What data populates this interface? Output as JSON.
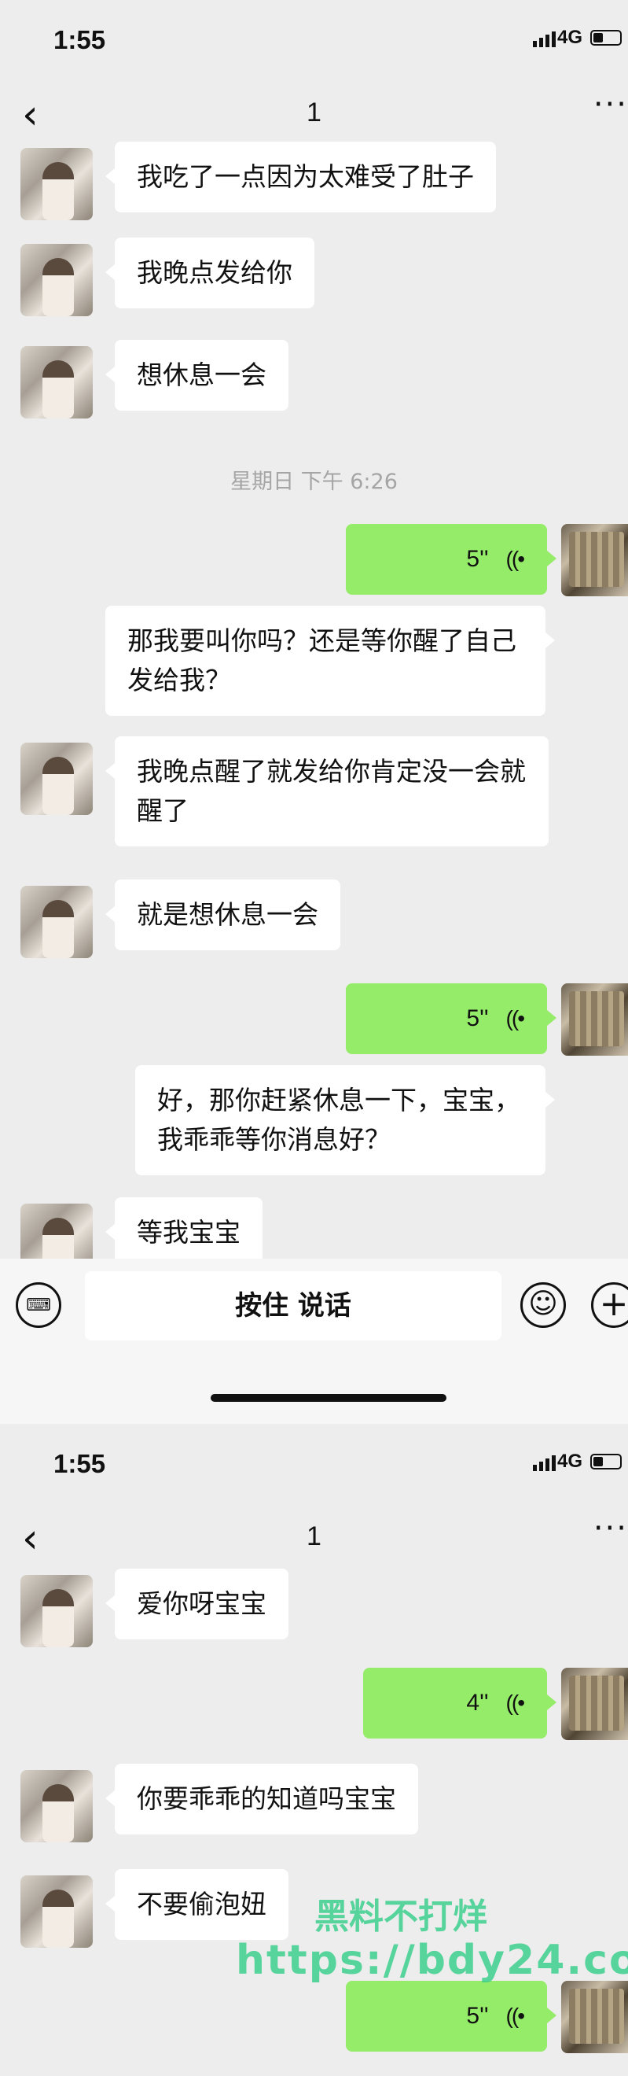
{
  "screens": [
    {
      "status": {
        "time": "1:55",
        "network": "4G"
      },
      "nav": {
        "back_icon": "‹",
        "title": "1",
        "more_icon": "···"
      },
      "messages": [
        {
          "side": "in",
          "text": "我吃了一点因为太难受了肚子"
        },
        {
          "side": "in",
          "text": "我晚点发给你"
        },
        {
          "side": "in",
          "text": "想休息一会"
        },
        {
          "type": "time",
          "text": "星期日 下午 6:26"
        },
        {
          "side": "out",
          "type": "voice",
          "duration": "5''"
        },
        {
          "side": "out",
          "text": "那我要叫你吗？还是等你醒了自己发给我？"
        },
        {
          "side": "in",
          "text": "我晚点醒了就发给你肯定没一会就醒了"
        },
        {
          "side": "in",
          "text": "就是想休息一会"
        },
        {
          "side": "out",
          "type": "voice",
          "duration": "5''"
        },
        {
          "side": "out",
          "text": "好，那你赶紧休息一下，宝宝，我乖乖等你消息好？"
        },
        {
          "side": "in",
          "text": "等我宝宝"
        }
      ],
      "input": {
        "hold_to_talk": "按住 说话"
      }
    },
    {
      "status": {
        "time": "1:55",
        "network": "4G"
      },
      "nav": {
        "back_icon": "‹",
        "title": "1",
        "more_icon": "···"
      },
      "messages": [
        {
          "side": "in",
          "text": "爱你呀宝宝"
        },
        {
          "side": "out",
          "type": "voice",
          "duration": "4''"
        },
        {
          "side": "in",
          "text": "你要乖乖的知道吗宝宝"
        },
        {
          "side": "in",
          "text": "不要偷泡妞"
        },
        {
          "side": "out",
          "type": "voice",
          "duration": "5''"
        }
      ]
    }
  ],
  "watermark": {
    "line1": "黑料不打烊",
    "line2": "https://bdy24.co"
  },
  "colors": {
    "background": "#ededed",
    "outgoing_bubble": "#95ec69",
    "incoming_bubble": "#ffffff",
    "watermark": "#3ecf8e"
  },
  "icons": [
    "back-icon",
    "more-icon",
    "signal-icon",
    "battery-icon",
    "voice-wave-icon",
    "keyboard-icon",
    "emoji-icon",
    "plus-icon"
  ]
}
